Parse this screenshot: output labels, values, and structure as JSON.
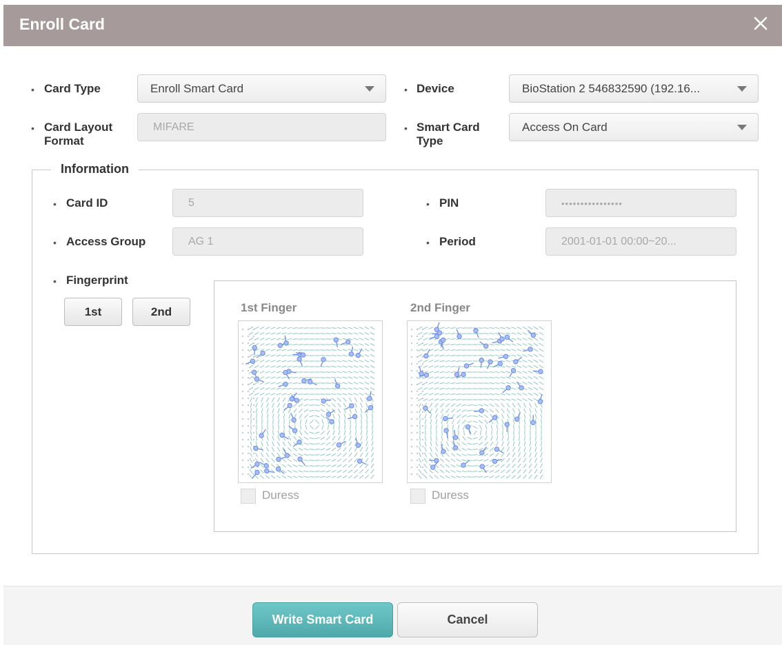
{
  "dialog": {
    "title": "Enroll Card",
    "close_icon": "close-icon"
  },
  "form": {
    "card_type": {
      "label": "Card Type",
      "value": "Enroll Smart Card"
    },
    "device": {
      "label": "Device",
      "value": "BioStation 2 546832590 (192.16..."
    },
    "card_layout_format": {
      "label_line1": "Card Layout",
      "label_line2": "Format",
      "value": "MIFARE"
    },
    "smart_card_type": {
      "label_line1": "Smart Card",
      "label_line2": "Type",
      "value": "Access On Card"
    }
  },
  "information": {
    "legend": "Information",
    "card_id": {
      "label": "Card ID",
      "value": "5"
    },
    "pin": {
      "label": "PIN",
      "value": "••••••••••••••••"
    },
    "access_group": {
      "label": "Access Group",
      "value": "AG 1"
    },
    "period": {
      "label": "Period",
      "value": "2001-01-01 00:00~20..."
    },
    "fingerprint": {
      "label": "Fingerprint",
      "btn_1st": "1st",
      "btn_2nd": "2nd",
      "finger1": {
        "label": "1st Finger",
        "duress_label": "Duress",
        "duress_checked": false
      },
      "finger2": {
        "label": "2nd Finger",
        "duress_label": "Duress",
        "duress_checked": false
      }
    }
  },
  "footer": {
    "write_label": "Write Smart Card",
    "cancel_label": "Cancel"
  },
  "colors": {
    "titlebar": "#a69a9b",
    "primary": "#5bb8b9",
    "minutiae": "#6b8de8"
  }
}
